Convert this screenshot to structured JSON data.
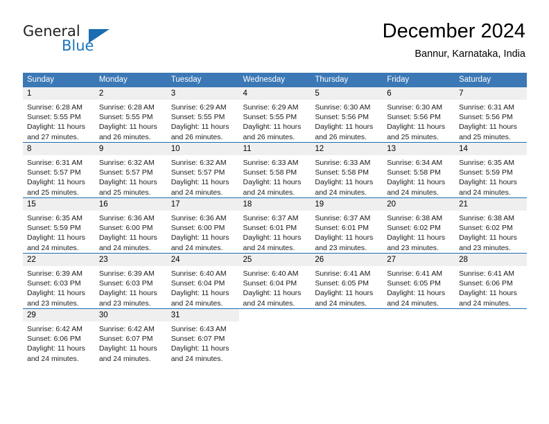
{
  "brand": {
    "name_part1": "General",
    "name_part2": "Blue",
    "accent_color": "#1b6cb0"
  },
  "header": {
    "title": "December 2024",
    "location": "Bannur, Karnataka, India"
  },
  "calendar": {
    "header_bg": "#3b78b5",
    "daynum_bg": "#efefef",
    "row_line_color": "#1b6cb0",
    "weekday_headers": [
      "Sunday",
      "Monday",
      "Tuesday",
      "Wednesday",
      "Thursday",
      "Friday",
      "Saturday"
    ],
    "weeks": [
      [
        {
          "day": "1",
          "sunrise": "Sunrise: 6:28 AM",
          "sunset": "Sunset: 5:55 PM",
          "daylight_line1": "Daylight: 11 hours",
          "daylight_line2": "and 27 minutes."
        },
        {
          "day": "2",
          "sunrise": "Sunrise: 6:28 AM",
          "sunset": "Sunset: 5:55 PM",
          "daylight_line1": "Daylight: 11 hours",
          "daylight_line2": "and 26 minutes."
        },
        {
          "day": "3",
          "sunrise": "Sunrise: 6:29 AM",
          "sunset": "Sunset: 5:55 PM",
          "daylight_line1": "Daylight: 11 hours",
          "daylight_line2": "and 26 minutes."
        },
        {
          "day": "4",
          "sunrise": "Sunrise: 6:29 AM",
          "sunset": "Sunset: 5:55 PM",
          "daylight_line1": "Daylight: 11 hours",
          "daylight_line2": "and 26 minutes."
        },
        {
          "day": "5",
          "sunrise": "Sunrise: 6:30 AM",
          "sunset": "Sunset: 5:56 PM",
          "daylight_line1": "Daylight: 11 hours",
          "daylight_line2": "and 26 minutes."
        },
        {
          "day": "6",
          "sunrise": "Sunrise: 6:30 AM",
          "sunset": "Sunset: 5:56 PM",
          "daylight_line1": "Daylight: 11 hours",
          "daylight_line2": "and 25 minutes."
        },
        {
          "day": "7",
          "sunrise": "Sunrise: 6:31 AM",
          "sunset": "Sunset: 5:56 PM",
          "daylight_line1": "Daylight: 11 hours",
          "daylight_line2": "and 25 minutes."
        }
      ],
      [
        {
          "day": "8",
          "sunrise": "Sunrise: 6:31 AM",
          "sunset": "Sunset: 5:57 PM",
          "daylight_line1": "Daylight: 11 hours",
          "daylight_line2": "and 25 minutes."
        },
        {
          "day": "9",
          "sunrise": "Sunrise: 6:32 AM",
          "sunset": "Sunset: 5:57 PM",
          "daylight_line1": "Daylight: 11 hours",
          "daylight_line2": "and 25 minutes."
        },
        {
          "day": "10",
          "sunrise": "Sunrise: 6:32 AM",
          "sunset": "Sunset: 5:57 PM",
          "daylight_line1": "Daylight: 11 hours",
          "daylight_line2": "and 24 minutes."
        },
        {
          "day": "11",
          "sunrise": "Sunrise: 6:33 AM",
          "sunset": "Sunset: 5:58 PM",
          "daylight_line1": "Daylight: 11 hours",
          "daylight_line2": "and 24 minutes."
        },
        {
          "day": "12",
          "sunrise": "Sunrise: 6:33 AM",
          "sunset": "Sunset: 5:58 PM",
          "daylight_line1": "Daylight: 11 hours",
          "daylight_line2": "and 24 minutes."
        },
        {
          "day": "13",
          "sunrise": "Sunrise: 6:34 AM",
          "sunset": "Sunset: 5:58 PM",
          "daylight_line1": "Daylight: 11 hours",
          "daylight_line2": "and 24 minutes."
        },
        {
          "day": "14",
          "sunrise": "Sunrise: 6:35 AM",
          "sunset": "Sunset: 5:59 PM",
          "daylight_line1": "Daylight: 11 hours",
          "daylight_line2": "and 24 minutes."
        }
      ],
      [
        {
          "day": "15",
          "sunrise": "Sunrise: 6:35 AM",
          "sunset": "Sunset: 5:59 PM",
          "daylight_line1": "Daylight: 11 hours",
          "daylight_line2": "and 24 minutes."
        },
        {
          "day": "16",
          "sunrise": "Sunrise: 6:36 AM",
          "sunset": "Sunset: 6:00 PM",
          "daylight_line1": "Daylight: 11 hours",
          "daylight_line2": "and 24 minutes."
        },
        {
          "day": "17",
          "sunrise": "Sunrise: 6:36 AM",
          "sunset": "Sunset: 6:00 PM",
          "daylight_line1": "Daylight: 11 hours",
          "daylight_line2": "and 24 minutes."
        },
        {
          "day": "18",
          "sunrise": "Sunrise: 6:37 AM",
          "sunset": "Sunset: 6:01 PM",
          "daylight_line1": "Daylight: 11 hours",
          "daylight_line2": "and 24 minutes."
        },
        {
          "day": "19",
          "sunrise": "Sunrise: 6:37 AM",
          "sunset": "Sunset: 6:01 PM",
          "daylight_line1": "Daylight: 11 hours",
          "daylight_line2": "and 23 minutes."
        },
        {
          "day": "20",
          "sunrise": "Sunrise: 6:38 AM",
          "sunset": "Sunset: 6:02 PM",
          "daylight_line1": "Daylight: 11 hours",
          "daylight_line2": "and 23 minutes."
        },
        {
          "day": "21",
          "sunrise": "Sunrise: 6:38 AM",
          "sunset": "Sunset: 6:02 PM",
          "daylight_line1": "Daylight: 11 hours",
          "daylight_line2": "and 23 minutes."
        }
      ],
      [
        {
          "day": "22",
          "sunrise": "Sunrise: 6:39 AM",
          "sunset": "Sunset: 6:03 PM",
          "daylight_line1": "Daylight: 11 hours",
          "daylight_line2": "and 23 minutes."
        },
        {
          "day": "23",
          "sunrise": "Sunrise: 6:39 AM",
          "sunset": "Sunset: 6:03 PM",
          "daylight_line1": "Daylight: 11 hours",
          "daylight_line2": "and 23 minutes."
        },
        {
          "day": "24",
          "sunrise": "Sunrise: 6:40 AM",
          "sunset": "Sunset: 6:04 PM",
          "daylight_line1": "Daylight: 11 hours",
          "daylight_line2": "and 24 minutes."
        },
        {
          "day": "25",
          "sunrise": "Sunrise: 6:40 AM",
          "sunset": "Sunset: 6:04 PM",
          "daylight_line1": "Daylight: 11 hours",
          "daylight_line2": "and 24 minutes."
        },
        {
          "day": "26",
          "sunrise": "Sunrise: 6:41 AM",
          "sunset": "Sunset: 6:05 PM",
          "daylight_line1": "Daylight: 11 hours",
          "daylight_line2": "and 24 minutes."
        },
        {
          "day": "27",
          "sunrise": "Sunrise: 6:41 AM",
          "sunset": "Sunset: 6:05 PM",
          "daylight_line1": "Daylight: 11 hours",
          "daylight_line2": "and 24 minutes."
        },
        {
          "day": "28",
          "sunrise": "Sunrise: 6:41 AM",
          "sunset": "Sunset: 6:06 PM",
          "daylight_line1": "Daylight: 11 hours",
          "daylight_line2": "and 24 minutes."
        }
      ],
      [
        {
          "day": "29",
          "sunrise": "Sunrise: 6:42 AM",
          "sunset": "Sunset: 6:06 PM",
          "daylight_line1": "Daylight: 11 hours",
          "daylight_line2": "and 24 minutes."
        },
        {
          "day": "30",
          "sunrise": "Sunrise: 6:42 AM",
          "sunset": "Sunset: 6:07 PM",
          "daylight_line1": "Daylight: 11 hours",
          "daylight_line2": "and 24 minutes."
        },
        {
          "day": "31",
          "sunrise": "Sunrise: 6:43 AM",
          "sunset": "Sunset: 6:07 PM",
          "daylight_line1": "Daylight: 11 hours",
          "daylight_line2": "and 24 minutes."
        },
        {
          "day": "",
          "sunrise": "",
          "sunset": "",
          "daylight_line1": "",
          "daylight_line2": ""
        },
        {
          "day": "",
          "sunrise": "",
          "sunset": "",
          "daylight_line1": "",
          "daylight_line2": ""
        },
        {
          "day": "",
          "sunrise": "",
          "sunset": "",
          "daylight_line1": "",
          "daylight_line2": ""
        },
        {
          "day": "",
          "sunrise": "",
          "sunset": "",
          "daylight_line1": "",
          "daylight_line2": ""
        }
      ]
    ]
  }
}
